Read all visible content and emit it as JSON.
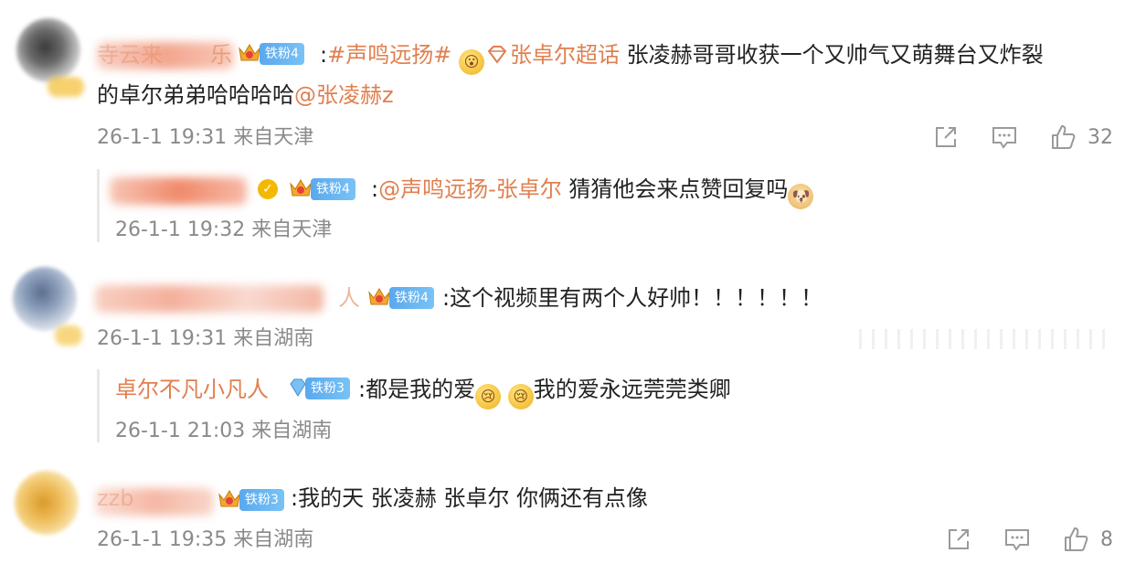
{
  "comments": [
    {
      "name_visible": "寺云来",
      "name_visible_tail": "乐",
      "badge": "铁粉4",
      "text_prefix": ":",
      "topic": "#声鸣远扬#",
      "supertopic": "张卓尔超话",
      "body_line1": "张凌赫哥哥收获一个又帅气又萌舞台又炸裂",
      "body_line2": "的卓尔弟弟哈哈哈哈",
      "mention": "@张凌赫z",
      "meta": "26-1-1 19:31 来自天津",
      "likes": "32",
      "reply": {
        "badge": "铁粉4",
        "text_prefix": ":",
        "mention": "@声鸣远扬-张卓尔",
        "body": "猜猜他会来点赞回复吗",
        "meta": "26-1-1 19:32 来自天津"
      }
    },
    {
      "name_visible_tail": "人",
      "badge": "铁粉4",
      "text": ":这个视频里有两个人好帅！！！！！！",
      "meta": "26-1-1 19:31 来自湖南",
      "reply": {
        "name": "卓尔不凡小凡人",
        "badge": "铁粉3",
        "text1": ":都是我的爱",
        "text2": "我的爱永远莞莞类卿",
        "meta": "26-1-1 21:03 来自湖南"
      }
    },
    {
      "name_visible": "zzb",
      "badge": "铁粉3",
      "text": ":我的天 张凌赫 张卓尔 你俩还有点像",
      "meta": "26-1-1 19:35 来自湖南",
      "likes": "8"
    }
  ],
  "icons": {
    "share": "share-icon",
    "comment": "comment-icon",
    "like": "like-icon",
    "crown": "crown-icon",
    "diamond": "diamond-icon"
  },
  "colors": {
    "accent": "#e07f4f",
    "meta": "#8a8a8a",
    "badge_blue": "#5aa9ee"
  }
}
